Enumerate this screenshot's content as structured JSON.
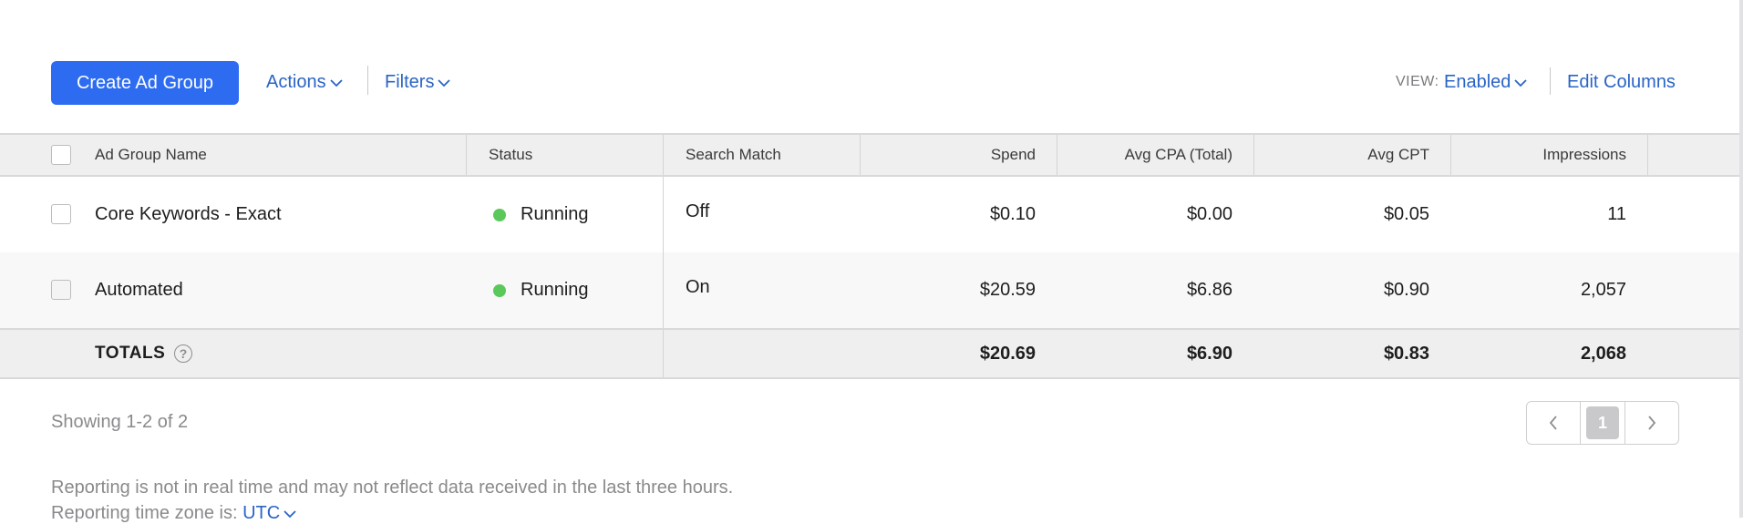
{
  "toolbar": {
    "create_label": "Create Ad Group",
    "actions_label": "Actions",
    "filters_label": "Filters",
    "view_label": "VIEW:",
    "view_value": "Enabled",
    "edit_columns_label": "Edit Columns"
  },
  "table": {
    "headers": {
      "name": "Ad Group Name",
      "status": "Status",
      "search_match": "Search Match",
      "spend": "Spend",
      "avg_cpa": "Avg CPA (Total)",
      "avg_cpt": "Avg CPT",
      "impressions": "Impressions"
    },
    "rows": [
      {
        "name": "Core Keywords - Exact",
        "status": "Running",
        "search_match": "Off",
        "spend": "$0.10",
        "avg_cpa": "$0.00",
        "avg_cpt": "$0.05",
        "impressions": "11"
      },
      {
        "name": "Automated",
        "status": "Running",
        "search_match": "On",
        "spend": "$20.59",
        "avg_cpa": "$6.86",
        "avg_cpt": "$0.90",
        "impressions": "2,057"
      }
    ],
    "totals": {
      "label": "TOTALS",
      "spend": "$20.69",
      "avg_cpa": "$6.90",
      "avg_cpt": "$0.83",
      "impressions": "2,068"
    }
  },
  "footer": {
    "showing": "Showing 1-2 of 2",
    "current_page": "1",
    "reporting_note": "Reporting is not in real time and may not reflect data received in the last three hours.",
    "timezone_label": "Reporting time zone is:",
    "timezone_value": "UTC"
  },
  "colors": {
    "accent": "#2d6cf0",
    "link": "#2a64c5",
    "running": "#5ac85a"
  },
  "icons": {
    "help": "question-circle-icon",
    "chevron": "chevron-down-icon",
    "prev": "chevron-left-icon",
    "next": "chevron-right-icon"
  }
}
